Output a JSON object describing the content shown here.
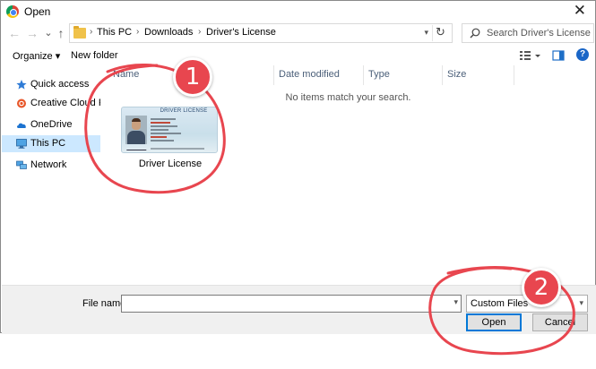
{
  "window": {
    "title": "Open",
    "close_glyph": "✕",
    "app_icon": "chrome-icon"
  },
  "nav": {
    "back": "←",
    "forward": "→",
    "recent": "⌄",
    "up": "↑",
    "refresh": "↻"
  },
  "address": {
    "crumbs": [
      "This PC",
      "Downloads",
      "Driver's License"
    ],
    "separator": "›"
  },
  "search": {
    "placeholder": "Search Driver's License"
  },
  "toolbar": {
    "organize": "Organize ▾",
    "new_folder": "New folder",
    "help": "?"
  },
  "sidebar": {
    "items": [
      {
        "label": "Quick access",
        "icon": "star-icon"
      },
      {
        "label": "Creative Cloud Files",
        "icon": "creative-cloud-icon"
      },
      {
        "label": "OneDrive",
        "icon": "cloud-icon"
      },
      {
        "label": "This PC",
        "icon": "computer-icon",
        "selected": true
      },
      {
        "label": "Network",
        "icon": "network-icon"
      }
    ]
  },
  "columns": {
    "name": "Name",
    "date_modified": "Date modified",
    "type": "Type",
    "size": "Size"
  },
  "empty_message": "No items match your search.",
  "file": {
    "name": "Driver License",
    "card_title": "DRIVER LICENSE"
  },
  "bottom": {
    "file_name_label": "File name:",
    "file_name_value": "",
    "file_type": "Custom Files",
    "open_label": "Open",
    "cancel_label": "Cancel"
  },
  "annotations": {
    "step1": "1",
    "step2": "2"
  },
  "colors": {
    "annotation_red": "#e8464f",
    "selection_blue": "#cce8ff",
    "accent": "#0078d7"
  }
}
